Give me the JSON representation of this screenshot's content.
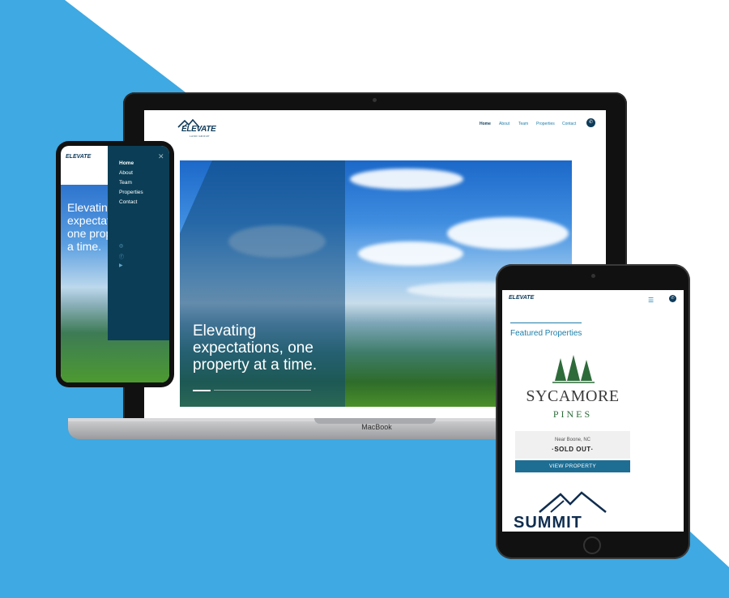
{
  "colors": {
    "accent": "#3ea9e3",
    "brand_navy": "#0e3b5a",
    "brand_blue": "#1d7ea8"
  },
  "laptop": {
    "device_label": "MacBook",
    "logo_text": "ELEVATE",
    "logo_sub": "LAND GROUP",
    "nav": [
      "Home",
      "About",
      "Team",
      "Properties",
      "Contact"
    ],
    "phone_icon": "phone-icon",
    "hero_text": "Elevating expectations, one property at a time."
  },
  "phone": {
    "logo_text": "ELEVATE",
    "hero_text": "Elevating expectations, one property at a time.",
    "menu": [
      "Home",
      "About",
      "Team",
      "Properties",
      "Contact"
    ],
    "close_icon": "close-icon",
    "social_icons": [
      "instagram-icon",
      "facebook-icon",
      "youtube-icon"
    ]
  },
  "tablet": {
    "logo_text": "ELEVATE",
    "featured_heading": "Featured Properties",
    "property_name_1": "SYCAMORE",
    "property_name_2": "PINES",
    "location": "Near Boone, NC",
    "status": "·SOLD OUT·",
    "button": "VIEW PROPERTY",
    "next_property": "SUMMIT"
  }
}
